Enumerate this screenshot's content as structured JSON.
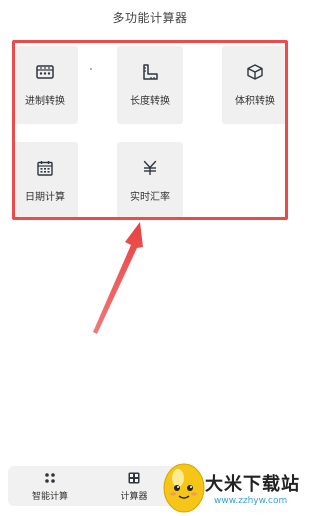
{
  "header": {
    "title": "多功能计算器"
  },
  "tiles": [
    {
      "label": "进制转换",
      "icon": "abacus-icon"
    },
    {
      "label": "长度转换",
      "icon": "ruler-icon"
    },
    {
      "label": "体积转换",
      "icon": "cube-icon"
    },
    {
      "label": "日期计算",
      "icon": "calendar-icon"
    },
    {
      "label": "实时汇率",
      "icon": "yen-icon"
    }
  ],
  "bottom_nav": [
    {
      "label": "智能计算",
      "icon": "apps-grid-icon"
    },
    {
      "label": "计算器",
      "icon": "calculator-icon"
    }
  ],
  "watermark": {
    "text": "大米下载站",
    "url": "www.zzhyw.com"
  },
  "colors": {
    "annotation": "#ef4a4a",
    "tile_bg": "#f0f0f0",
    "icon": "#2f3640"
  }
}
